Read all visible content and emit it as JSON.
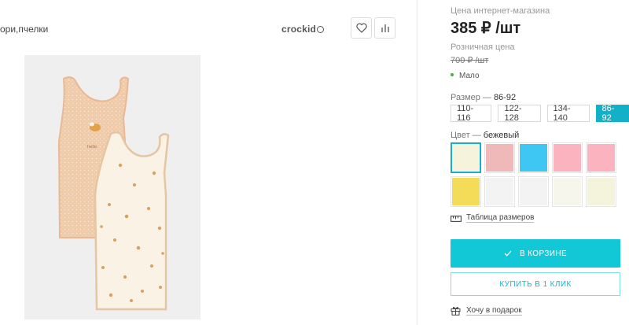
{
  "header": {
    "title_fragment": "ори,пчелки",
    "brand": "crockid"
  },
  "icons": {
    "wishlist": "heart-icon",
    "compare": "bar-chart-icon"
  },
  "product": {
    "online_price_label": "Цена интернет-магазина",
    "online_price": "385 ₽ /шт",
    "retail_price_label": "Розничная цена",
    "retail_price": "700 ₽ /шт",
    "stock": "Мало"
  },
  "size": {
    "label": "Размер",
    "selected": "86-92",
    "options": [
      "110-116",
      "122-128",
      "134-140",
      "86-92"
    ]
  },
  "color": {
    "label": "Цвет",
    "selected": "бежевый",
    "swatches": [
      "#f5f3dc",
      "#f0b9b9",
      "#3ec7f2",
      "#fbb3c0",
      "#fbb3c0",
      "#f4dc58",
      "#f3f3f3",
      "#f3f3f3",
      "#f7f6ec",
      "#f4f4dc"
    ]
  },
  "links": {
    "size_table": "Таблица размеров",
    "gift": "Хочу в подарок"
  },
  "buttons": {
    "in_cart": "В КОРЗИНЕ",
    "one_click": "КУПИТЬ В 1 КЛИК"
  },
  "colors": {
    "accent": "#12c7d6",
    "stock_dot": "#3bb54a"
  }
}
